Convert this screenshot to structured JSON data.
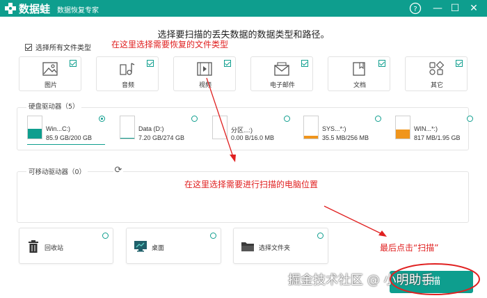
{
  "titlebar": {
    "app_name": "数据蛙",
    "subtitle": "数据恢复专家",
    "help": "?",
    "minimize": "—",
    "maximize": "☐",
    "close": "✕"
  },
  "instruction": "选择要扫描的丢失数据的数据类型和路径。",
  "select_all": {
    "label": "选择所有文件类型",
    "checked": true
  },
  "annotations": {
    "file_type_note": "在这里选择需要恢复的文件类型",
    "location_note": "在这里选择需要进行扫描的电脑位置",
    "scan_note": "最后点击“扫描”"
  },
  "file_types": [
    {
      "label": "图片",
      "icon": "image-icon",
      "checked": true
    },
    {
      "label": "音频",
      "icon": "music-icon",
      "checked": true
    },
    {
      "label": "视频",
      "icon": "video-icon",
      "checked": true
    },
    {
      "label": "电子邮件",
      "icon": "email-icon",
      "checked": true
    },
    {
      "label": "文档",
      "icon": "document-icon",
      "checked": true
    },
    {
      "label": "其它",
      "icon": "other-icon",
      "checked": true
    }
  ],
  "drives_section": {
    "title": "硬盘驱动器（5）",
    "drives": [
      {
        "name": "Win...C:)",
        "size": "85.9 GB/200 GB",
        "selected": true,
        "usage": 0.43,
        "color": "#0e9e8e"
      },
      {
        "name": "Data (D:)",
        "size": "7.20 GB/274 GB",
        "selected": false,
        "usage": 0.03,
        "color": "#0e9e8e"
      },
      {
        "name": "分区...:)",
        "size": "0.00  B/16.0 MB",
        "selected": false,
        "usage": 0.0,
        "color": "#f0951c"
      },
      {
        "name": "SYS...*:)",
        "size": "35.5 MB/256 MB",
        "selected": false,
        "usage": 0.14,
        "color": "#f0951c"
      },
      {
        "name": "WIN...*:)",
        "size": "817 MB/1.95 GB",
        "selected": false,
        "usage": 0.42,
        "color": "#f0951c"
      }
    ]
  },
  "removable_section": {
    "title": "可移动驱动器（0）",
    "refresh_icon": "refresh-icon",
    "refresh_glyph": "⟳"
  },
  "locations": [
    {
      "label": "回收站",
      "icon": "recycle-bin-icon"
    },
    {
      "label": "桌面",
      "icon": "desktop-icon"
    },
    {
      "label": "选择文件夹",
      "icon": "folder-icon"
    }
  ],
  "scan_button": {
    "label": "扫描"
  },
  "watermark": "掘金技术社区 @ 小明助手",
  "colors": {
    "brand": "#0e9e8e",
    "annotation": "#e02020",
    "warning_drive": "#f0951c"
  }
}
